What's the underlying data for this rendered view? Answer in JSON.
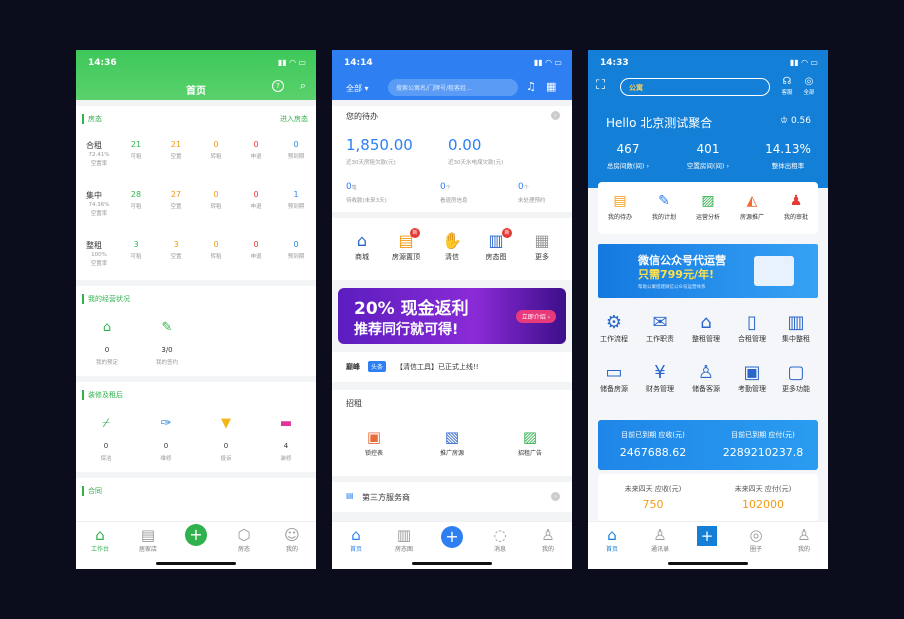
{
  "phone1": {
    "time": "14:36",
    "title": "首页",
    "section_fangtai": "房态",
    "enter_fangtai": "进入房态",
    "rows": [
      {
        "name": "合租",
        "rate": "72.41%",
        "rate_label": "空置率",
        "values": [
          "21",
          "21",
          "0",
          "0",
          "0"
        ]
      },
      {
        "name": "集中",
        "rate": "74.36%",
        "rate_label": "空置率",
        "values": [
          "28",
          "27",
          "0",
          "0",
          "1"
        ]
      },
      {
        "name": "整租",
        "rate": "100%",
        "rate_label": "空置率",
        "values": [
          "3",
          "3",
          "0",
          "0",
          "0"
        ]
      }
    ],
    "col_labels": [
      "可租",
      "空置",
      "转租",
      "申退",
      "预到期"
    ],
    "section_jingying": "我的经营状况",
    "jingying": [
      {
        "value": "0",
        "label": "我的预定"
      },
      {
        "value": "3/0",
        "label": "我的签约"
      }
    ],
    "section_zhuangxiu": "装修及租后",
    "zhuangxiu": [
      {
        "value": "0",
        "label": "保洁"
      },
      {
        "value": "0",
        "label": "维修"
      },
      {
        "value": "0",
        "label": "投诉"
      },
      {
        "value": "4",
        "label": "装修"
      }
    ],
    "section_hetong": "合同",
    "tabs": [
      "工作台",
      "居家店",
      "",
      "房态",
      "我的"
    ]
  },
  "phone2": {
    "time": "14:14",
    "filter": "全部",
    "search_placeholder": "搜索公寓名/门牌号/租客姓...",
    "todo_title": "您的待办",
    "stat1_value": "1,850.00",
    "stat1_label": "近30天房租欠款(元)",
    "stat2_value": "0.00",
    "stat2_label": "近30天水电煤欠款(元)",
    "small_stats": [
      {
        "value": "0",
        "unit": "笔",
        "label": "待收款(未来3天)"
      },
      {
        "value": "0",
        "unit": "个",
        "label": "看退房信息"
      },
      {
        "value": "0",
        "unit": "个",
        "label": "未处理预约"
      }
    ],
    "shortcuts": [
      "商城",
      "房源置顶",
      "清信",
      "房态图",
      "更多"
    ],
    "badge_new": "新",
    "banner_line1": "20% 现金返利",
    "banner_line2": "推荐同行就可得!",
    "banner_btn": "立即介绍 ›",
    "news_brand": "巅峰",
    "news_tag": "头条",
    "news_text": "【清信工具】已正式上线!!",
    "zhaozu_title": "招租",
    "zhaozu_items": [
      "锁控表",
      "推广房源",
      "招租广告"
    ],
    "third_party": "第三方服务商",
    "tabs": [
      "首页",
      "房态图",
      "",
      "消息",
      "我的"
    ]
  },
  "phone3": {
    "time": "14:33",
    "brand_pill": "公寓",
    "top_icons": [
      "客服",
      "全部"
    ],
    "hello": "Hello  北京测试聚合",
    "coin": "0.56",
    "stats": [
      {
        "value": "467",
        "label": "总房间数(间) ›"
      },
      {
        "value": "401",
        "label": "空置房间(间) ›"
      },
      {
        "value": "14.13%",
        "label": "整体出租率"
      }
    ],
    "quick": [
      "我的待办",
      "我的计划",
      "运营分析",
      "房源推广",
      "我的审批"
    ],
    "ad_line1": "微信公众号代运营",
    "ad_line2": "只需799元/年!",
    "ad_line3": "帮助公寓搭建微信公众号运营体系",
    "func_row1": [
      "工作流程",
      "工作职责",
      "整租管理",
      "合租管理",
      "集中整租"
    ],
    "func_row2": [
      "储备房源",
      "财务管理",
      "储备客源",
      "考勤管理",
      "更多功能"
    ],
    "due_recv_label": "目前已到期 应收(元)",
    "due_recv_value": "2467688.62",
    "due_pay_label": "目前已到期 应付(元)",
    "due_pay_value": "2289210237.8",
    "future_recv_label": "未来四天 应收(元)",
    "future_recv_value": "750",
    "future_pay_label": "未来四天 应付(元)",
    "future_pay_value": "102000",
    "tabs": [
      "首页",
      "通讯录",
      "",
      "圈子",
      "我的"
    ],
    "colors": {
      "accent": "#137fd6",
      "orange": "#f39a15"
    }
  }
}
